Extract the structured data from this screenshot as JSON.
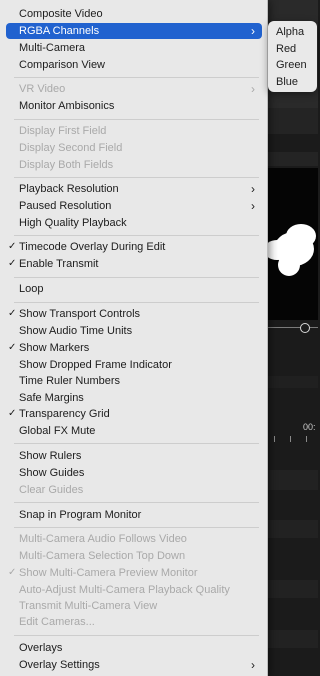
{
  "main_menu": {
    "items": [
      {
        "label": "Composite Video",
        "checked": false,
        "submenu": false,
        "disabled": false
      },
      {
        "label": "RGBA Channels",
        "checked": false,
        "submenu": true,
        "disabled": false,
        "selected": true
      },
      {
        "label": "Multi-Camera",
        "checked": false,
        "submenu": false,
        "disabled": false
      },
      {
        "label": "Comparison View",
        "checked": false,
        "submenu": false,
        "disabled": false
      },
      {
        "label": "VR Video",
        "checked": false,
        "submenu": true,
        "disabled": true
      },
      {
        "label": "Monitor Ambisonics",
        "checked": false,
        "submenu": false,
        "disabled": false
      },
      {
        "label": "Display First Field",
        "checked": false,
        "submenu": false,
        "disabled": true
      },
      {
        "label": "Display Second Field",
        "checked": false,
        "submenu": false,
        "disabled": true
      },
      {
        "label": "Display Both Fields",
        "checked": false,
        "submenu": false,
        "disabled": true
      },
      {
        "label": "Playback Resolution",
        "checked": false,
        "submenu": true,
        "disabled": false
      },
      {
        "label": "Paused Resolution",
        "checked": false,
        "submenu": true,
        "disabled": false
      },
      {
        "label": "High Quality Playback",
        "checked": false,
        "submenu": false,
        "disabled": false
      },
      {
        "label": "Timecode Overlay During Edit",
        "checked": true,
        "submenu": false,
        "disabled": false
      },
      {
        "label": "Enable Transmit",
        "checked": true,
        "submenu": false,
        "disabled": false
      },
      {
        "label": "Loop",
        "checked": false,
        "submenu": false,
        "disabled": false
      },
      {
        "label": "Show Transport Controls",
        "checked": true,
        "submenu": false,
        "disabled": false
      },
      {
        "label": "Show Audio Time Units",
        "checked": false,
        "submenu": false,
        "disabled": false
      },
      {
        "label": "Show Markers",
        "checked": true,
        "submenu": false,
        "disabled": false
      },
      {
        "label": "Show Dropped Frame Indicator",
        "checked": false,
        "submenu": false,
        "disabled": false
      },
      {
        "label": "Time Ruler Numbers",
        "checked": false,
        "submenu": false,
        "disabled": false
      },
      {
        "label": "Safe Margins",
        "checked": false,
        "submenu": false,
        "disabled": false
      },
      {
        "label": "Transparency Grid",
        "checked": true,
        "submenu": false,
        "disabled": false
      },
      {
        "label": "Global FX Mute",
        "checked": false,
        "submenu": false,
        "disabled": false
      },
      {
        "label": "Show Rulers",
        "checked": false,
        "submenu": false,
        "disabled": false
      },
      {
        "label": "Show Guides",
        "checked": false,
        "submenu": false,
        "disabled": false
      },
      {
        "label": "Clear Guides",
        "checked": false,
        "submenu": false,
        "disabled": true
      },
      {
        "label": "Snap in Program Monitor",
        "checked": false,
        "submenu": false,
        "disabled": false
      },
      {
        "label": "Multi-Camera Audio Follows Video",
        "checked": false,
        "submenu": false,
        "disabled": true
      },
      {
        "label": "Multi-Camera Selection Top Down",
        "checked": false,
        "submenu": false,
        "disabled": true
      },
      {
        "label": "Show Multi-Camera Preview Monitor",
        "checked": true,
        "submenu": false,
        "disabled": true
      },
      {
        "label": "Auto-Adjust Multi-Camera Playback Quality",
        "checked": false,
        "submenu": false,
        "disabled": true
      },
      {
        "label": "Transmit Multi-Camera View",
        "checked": false,
        "submenu": false,
        "disabled": true
      },
      {
        "label": "Edit Cameras...",
        "checked": false,
        "submenu": false,
        "disabled": true
      },
      {
        "label": "Overlays",
        "checked": false,
        "submenu": false,
        "disabled": false
      },
      {
        "label": "Overlay Settings",
        "checked": false,
        "submenu": true,
        "disabled": false
      }
    ]
  },
  "submenu": {
    "items": [
      {
        "label": "Alpha"
      },
      {
        "label": "Red"
      },
      {
        "label": "Green"
      },
      {
        "label": "Blue"
      }
    ]
  },
  "background": {
    "timecode_partial": "00:"
  },
  "icons": {
    "checkmark": "checkmark-icon",
    "submenu_arrow": "chevron-right-icon"
  },
  "colors": {
    "menu_bg": "#e8e8e8",
    "selected_bg": "#2162cf",
    "disabled_text": "#a9a9a9"
  }
}
